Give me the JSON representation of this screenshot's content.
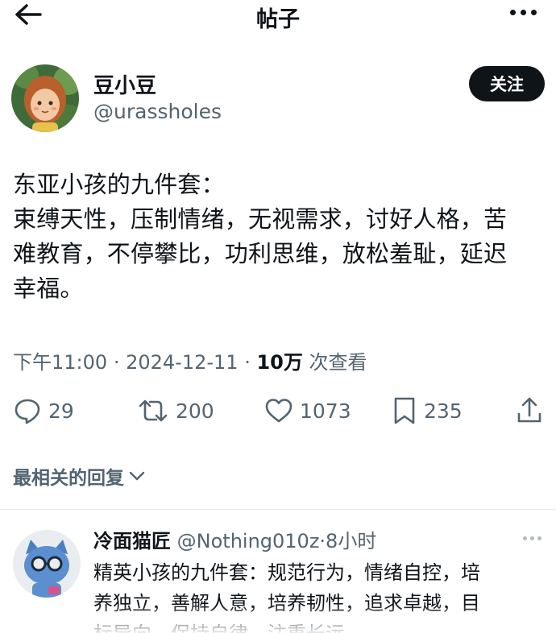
{
  "header": {
    "back_icon": "arrow-left-icon",
    "title": "帖子",
    "more_icon": "more-horizontal-icon"
  },
  "post": {
    "author": {
      "display_name": "豆小豆",
      "handle": "@urassholes",
      "follow_label": "关注"
    },
    "text": "东亚小孩的九件套：\n束缚天性，压制情绪，无视需求，讨好人格，苦\n难教育，不停攀比，功利思维，放松羞耻，延迟\n幸福。",
    "time": "下午11:00",
    "date": "2024-12-11",
    "views_count": "10万",
    "views_label": "次查看",
    "stats": {
      "replies": "29",
      "reposts": "200",
      "likes": "1073",
      "bookmarks": "235"
    }
  },
  "replies_sort": {
    "label": "最相关的回复",
    "icon": "chevron-down-icon"
  },
  "reply": {
    "display_name": "冷面猫匠",
    "handle": "@Nothing010z",
    "time": "·8小时",
    "text": "精英小孩的九件套：规范行为，情绪自控，培\n养独立，善解人意，培养韧性，追求卓越，目\n标导向，保持自律，注重长远"
  },
  "colors": {
    "text_primary": "#0f1419",
    "text_secondary": "#536471",
    "follow_bg": "#0f1419"
  }
}
